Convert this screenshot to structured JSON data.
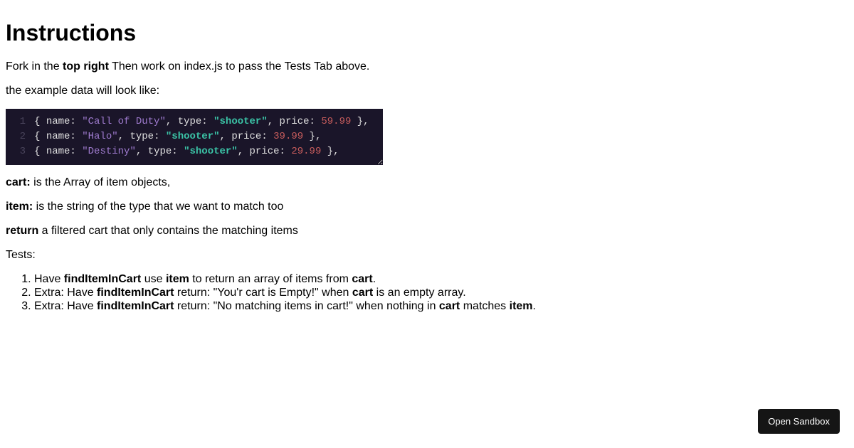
{
  "heading": "Instructions",
  "p1": {
    "a": "Fork in the ",
    "b": "top right",
    "c": " Then work on index.js to pass the Tests Tab above."
  },
  "p2": "the example data will look like:",
  "code": {
    "lines": [
      {
        "n": "1",
        "name": "Call of Duty",
        "type": "shooter",
        "price": "59.99"
      },
      {
        "n": "2",
        "name": "Halo",
        "type": "shooter",
        "price": "39.99"
      },
      {
        "n": "3",
        "name": "Destiny",
        "type": "shooter",
        "price": "29.99"
      }
    ]
  },
  "defs": {
    "cart_b": "cart:",
    "cart_t": " is the Array of item objects,",
    "item_b": "item:",
    "item_t": " is the string of the type that we want to match too",
    "return_b": "return",
    "return_t": " a filtered cart that only contains the matching items"
  },
  "tests_label": "Tests:",
  "tests": {
    "t1": {
      "a": "Have ",
      "b": "findItemInCart",
      "c": " use ",
      "d": "item",
      "e": " to return an array of items from ",
      "f": "cart",
      "g": "."
    },
    "t2": {
      "a": "Extra: Have ",
      "b": "findItemInCart",
      "c": " return: \"You'r cart is Empty!\" when ",
      "d": "cart",
      "e": " is an empty array."
    },
    "t3": {
      "a": "Extra: Have ",
      "b": "findItemInCart",
      "c": " return: \"No matching items in cart!\" when nothing in ",
      "d": "cart",
      "e": " matches ",
      "f": "item",
      "g": "."
    }
  },
  "button": "Open Sandbox"
}
